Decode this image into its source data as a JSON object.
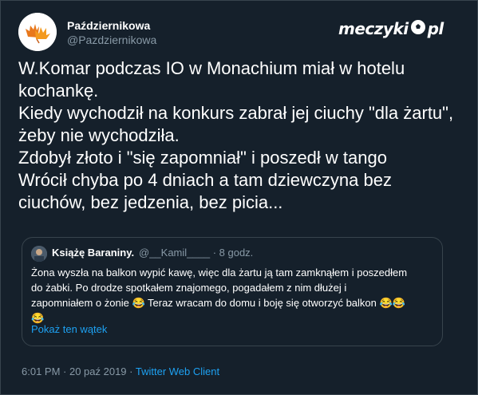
{
  "author": {
    "name": "Październikowa",
    "handle": "@Pazdziernikowa"
  },
  "brand": {
    "text_before": "meczyki",
    "text_after": "pl"
  },
  "tweet": {
    "lines": [
      "W.Komar podczas IO w Monachium miał w hotelu",
      "kochankę.",
      "Kiedy wychodził na konkurs zabrał jej ciuchy \"dla żartu\",",
      "żeby nie wychodziła.",
      "Zdobył złoto i \"się zapomniał\" i poszedł w tango",
      "Wrócił chyba po 4 dniach a tam dziewczyna bez",
      "ciuchów, bez jedzenia, bez picia..."
    ]
  },
  "quote": {
    "name": "Książę Baraniny.",
    "handle": "@__Kamil____ · 8 godz.",
    "lines": [
      "Żona wyszła na balkon wypić kawę, więc dla żartu ją tam zamknąłem i poszedłem",
      "do żabki. Po drodze spotkałem znajomego, pogadałem z nim dłużej i",
      "zapomniałem o żonie 😂 Teraz wracam do domu i boję się otworzyć balkon 😂😂",
      "😂"
    ],
    "show_thread": "Pokaż ten wątek"
  },
  "meta": {
    "time": "6:01 PM · 20 paź 2019 · ",
    "app": "Twitter Web Client"
  },
  "colors": {
    "background": "#15202b",
    "border": "#38444d",
    "secondary_text": "#8899a6",
    "link": "#1da1f2"
  }
}
